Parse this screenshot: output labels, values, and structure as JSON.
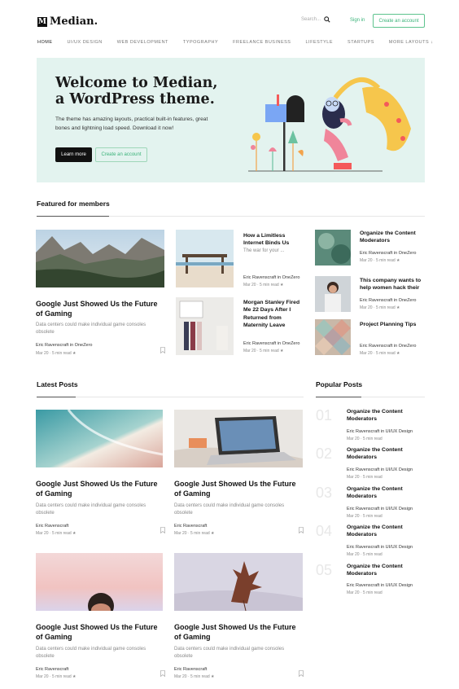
{
  "header": {
    "logo_mark": "M",
    "logo_text": "Median.",
    "search_placeholder": "Search...",
    "signin": "Sign in",
    "create_account": "Create an account"
  },
  "nav": [
    "HOME",
    "UI/UX DESIGN",
    "WEB DEVELOPMENT",
    "TYPOGRAPHY",
    "FREELANCE BUSINESS",
    "LIFESTYLE",
    "STARTUPS",
    "MORE LAYOUTS ↓"
  ],
  "hero": {
    "title_line1": "Welcome to Median,",
    "title_line2": "a WordPress theme.",
    "text": "The theme has amazing layouts, practical built-in features, great bones and lightning load speed. Download it now!",
    "learn_more": "Learn more",
    "create_account": "Create an account"
  },
  "featured": {
    "heading": "Featured for members",
    "main": {
      "title": "Google Just Showed Us the Future of Gaming",
      "excerpt": "Data centers could make individual game consoles obsolete",
      "author": "Eric Ravenscraft in OneZero",
      "date": "Mar 20",
      "read": "5 min read",
      "star": "★"
    },
    "mid": [
      {
        "title": "How a Limitless Internet Binds Us",
        "excerpt": "The war for your ...",
        "author": "Eric Ravenscraft in OneZero",
        "date": "Mar 20",
        "read": "5 min read",
        "star": "★"
      },
      {
        "title": "Morgan Stanley Fired Me 22 Days After I Returned from Maternity Leave",
        "excerpt": "",
        "author": "Eric Ravenscraft in OneZero",
        "date": "Mar 20",
        "read": "5 min read",
        "star": "★"
      }
    ],
    "right": [
      {
        "title": "Organize the Content Moderators",
        "author": "Eric Ravenscraft in OneZero",
        "date": "Mar 20",
        "read": "5 min read",
        "star": "★"
      },
      {
        "title": "This company wants to help women hack their",
        "author": "Eric Ravenscraft in OneZero",
        "date": "Mar 20",
        "read": "5 min read",
        "star": "★"
      },
      {
        "title": "Project Planning Tips",
        "author": "Eric Ravenscraft in OneZero",
        "date": "Mar 20",
        "read": "5 min read",
        "star": "★"
      }
    ]
  },
  "latest": {
    "heading": "Latest Posts",
    "posts": [
      {
        "title": "Google Just Showed Us the Future of Gaming",
        "excerpt": "Data centers could make individual game consoles obsolete",
        "author": "Eric Ravenscraft",
        "date": "Mar 20",
        "read": "5 min read",
        "star": "★"
      },
      {
        "title": "Google Just Showed Us the Future of Gaming",
        "excerpt": "Data centers could make individual game consoles obsolete",
        "author": "Eric Ravenscraft",
        "date": "Mar 20",
        "read": "5 min read",
        "star": "★"
      },
      {
        "title": "Google Just Showed Us the Future of Gaming",
        "excerpt": "Data centers could make individual game consoles obsolete",
        "author": "Eric Ravenscraft",
        "date": "Mar 20",
        "read": "5 min read",
        "star": "★"
      },
      {
        "title": "Google Just Showed Us the Future of Gaming",
        "excerpt": "Data centers could make individual game consoles obsolete",
        "author": "Eric Ravenscraft",
        "date": "Mar 20",
        "read": "5 min read",
        "star": "★"
      }
    ]
  },
  "popular": {
    "heading": "Popular Posts",
    "posts": [
      {
        "num": "01",
        "title": "Organize the Content Moderators",
        "author": "Eric Ravenscraft in UI/UX Design",
        "date": "Mar 20",
        "read": "5 min read"
      },
      {
        "num": "02",
        "title": "Organize the Content Moderators",
        "author": "Eric Ravenscraft in UI/UX Design",
        "date": "Mar 20",
        "read": "5 min read"
      },
      {
        "num": "03",
        "title": "Organize the Content Moderators",
        "author": "Eric Ravenscraft in UI/UX Design",
        "date": "Mar 20",
        "read": "5 min read"
      },
      {
        "num": "04",
        "title": "Organize the Content Moderators",
        "author": "Eric Ravenscraft in UI/UX Design",
        "date": "Mar 20",
        "read": "5 min read"
      },
      {
        "num": "05",
        "title": "Organize the Content Moderators",
        "author": "Eric Ravenscraft in UI/UX Design",
        "date": "Mar 20",
        "read": "5 min read"
      }
    ]
  },
  "icons": {
    "search": "search-icon",
    "bookmark": "bookmark-icon"
  },
  "colors": {
    "accent": "#3bb37a",
    "hero_bg": "#e3f3ef"
  }
}
